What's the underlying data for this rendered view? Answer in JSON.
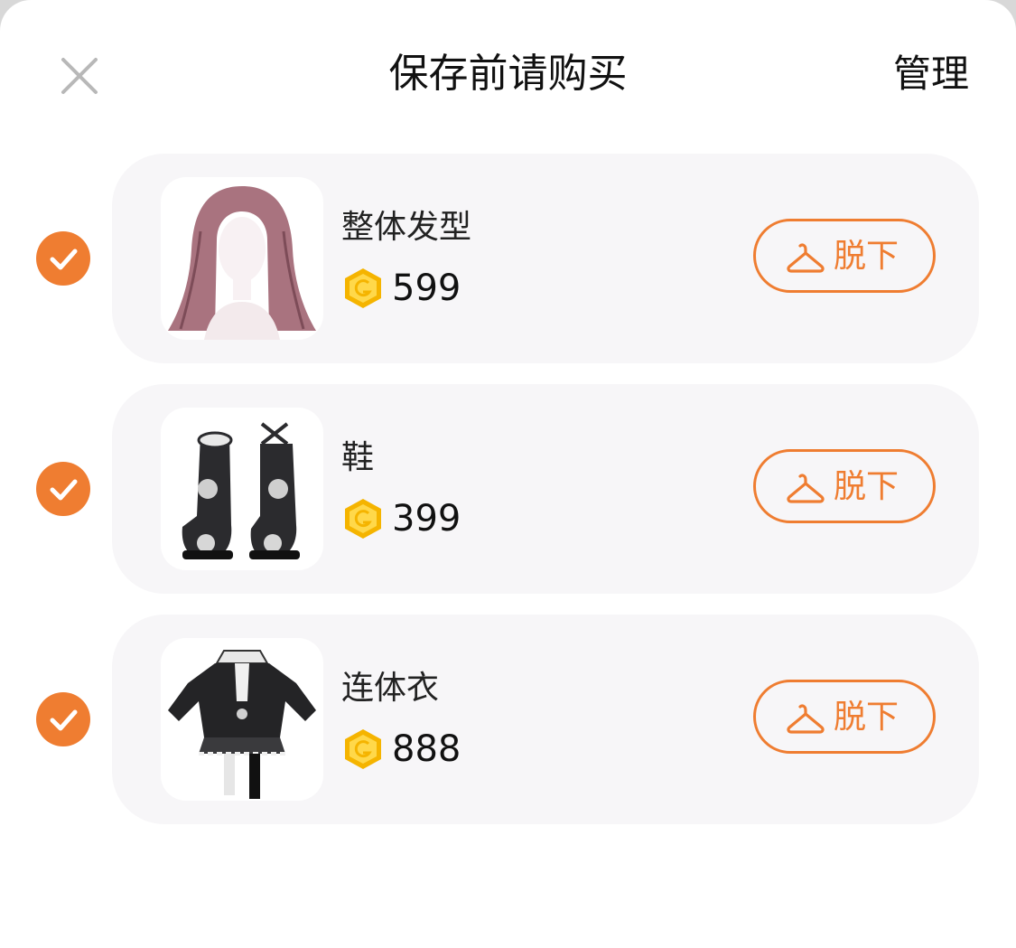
{
  "header": {
    "title": "保存前请购买",
    "manage_label": "管理"
  },
  "items": [
    {
      "name": "整体发型",
      "price": "599",
      "selected": true,
      "button_label": "脱下",
      "thumb_icon": "long-hair-icon"
    },
    {
      "name": "鞋",
      "price": "399",
      "selected": true,
      "button_label": "脱下",
      "thumb_icon": "boots-icon"
    },
    {
      "name": "连体衣",
      "price": "888",
      "selected": true,
      "button_label": "脱下",
      "thumb_icon": "outfit-icon"
    }
  ],
  "colors": {
    "accent": "#ef7d31",
    "coin": "#f5b400",
    "card_bg": "#f7f6f8"
  }
}
